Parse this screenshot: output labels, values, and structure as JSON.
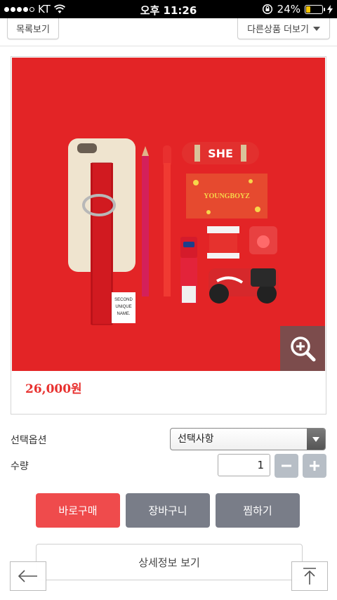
{
  "status_bar": {
    "carrier": "KT",
    "time": "오후 11:26",
    "battery": "24%",
    "battery_level": 0.24,
    "icons": [
      "signal-dots-icon",
      "wifi-icon",
      "rotation-lock-icon",
      "battery-icon",
      "charging-bolt-icon"
    ]
  },
  "nav": {
    "list_label": "목록보기",
    "more_label": "다른상품 더보기"
  },
  "product": {
    "price": "26,000원",
    "zoom_icon": "zoom-in-icon",
    "image_background": "#e32426",
    "case_print": [
      "SECOND",
      "UNIQUE",
      "NAME."
    ],
    "card_print": "YOUNGBOYZ",
    "deck_print": "SHE"
  },
  "options": {
    "option_label": "선택옵션",
    "select_value": "선택사항",
    "quantity_label": "수량",
    "quantity_value": "1"
  },
  "actions": {
    "buy_label": "바로구매",
    "cart_label": "장바구니",
    "wish_label": "찜하기",
    "detail_label": "상세정보 보기"
  },
  "floating": {
    "back_icon": "arrow-left-icon",
    "top_icon": "arrow-up-to-top-icon"
  },
  "colors": {
    "accent_red": "#ef4b4c",
    "price_red": "#e8312f",
    "gray_button": "#797d88",
    "qty_button": "#b7bec6"
  }
}
